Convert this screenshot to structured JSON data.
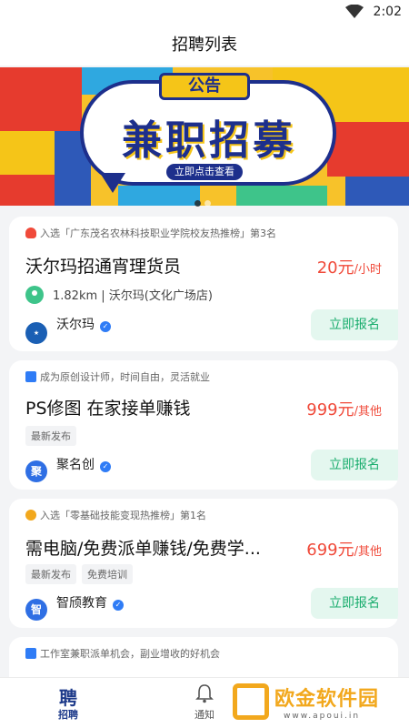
{
  "status_bar": {
    "time": "2:02"
  },
  "page": {
    "title": "招聘列表"
  },
  "banner": {
    "tag": "公告",
    "headline": "兼职招募",
    "cta": "立即点击查看",
    "colors": {
      "navy": "#1d2f8c",
      "yellow": "#f5c518",
      "red": "#e63b2e",
      "blue": "#2e59b8"
    }
  },
  "jobs": [
    {
      "tagline": "入选「广东茂名农林科技职业学院校友热推榜」第3名",
      "title": "沃尔玛招通宵理货员",
      "salary": "20元",
      "salary_unit": "/小时",
      "distance": "1.82km",
      "location": "沃尔玛(文化广场店)",
      "company": "沃尔玛",
      "apply": "立即报名"
    },
    {
      "tagline": "成为原创设计师，时间自由，灵活就业",
      "title": "PS修图 在家接单赚钱",
      "salary": "999元",
      "salary_unit": "/其他",
      "chips": [
        "最新发布"
      ],
      "company": "聚名创",
      "company_logo_text": "聚",
      "apply": "立即报名"
    },
    {
      "tagline": "入选「零基础技能变现热推榜」第1名",
      "title": "需电脑/免费派单赚钱/免费学...",
      "salary": "699元",
      "salary_unit": "/其他",
      "chips": [
        "最新发布",
        "免费培训"
      ],
      "company": "智颀教育",
      "company_logo_text": "智",
      "apply": "立即报名"
    },
    {
      "tagline": "工作室兼职派单机会，副业增收的好机会"
    }
  ],
  "tabbar": {
    "tabs": [
      {
        "label": "招聘",
        "icon": "recruit-icon"
      },
      {
        "label": "通知",
        "icon": "bell-icon"
      }
    ]
  },
  "watermark": {
    "text": "欧金软件园",
    "url": "www.apoui.in"
  }
}
